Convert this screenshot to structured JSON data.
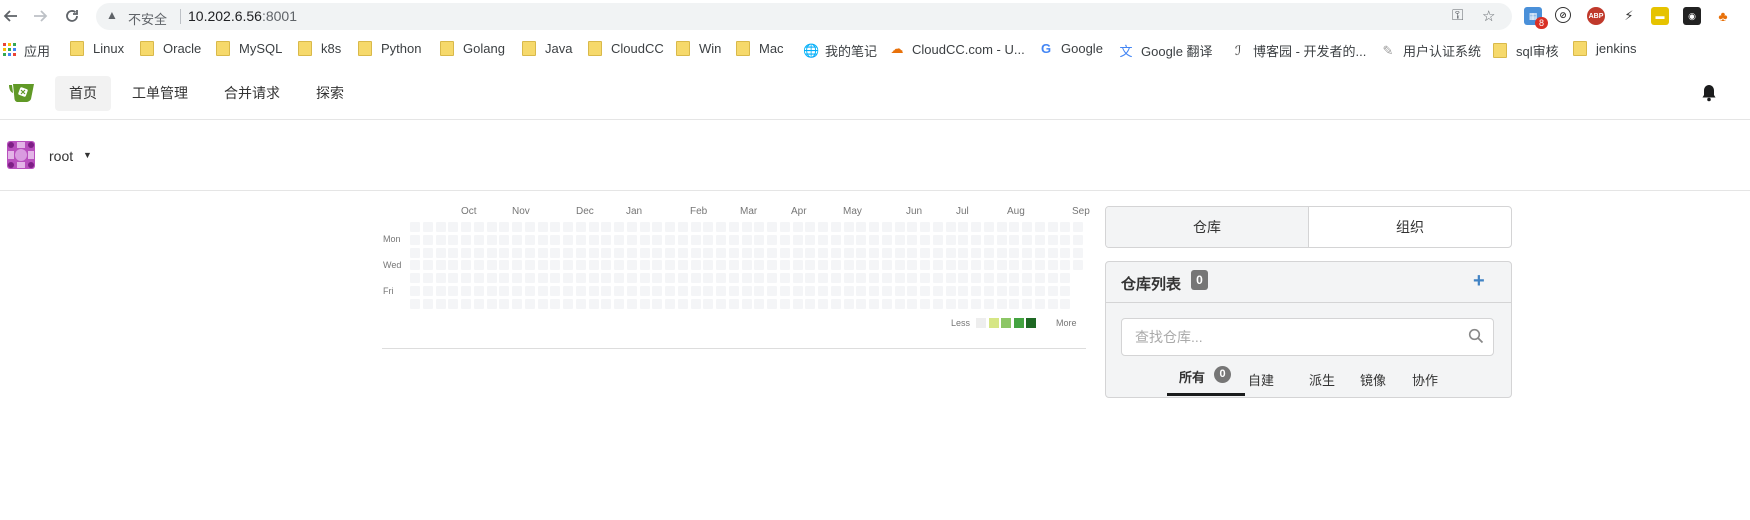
{
  "browser": {
    "insecure_label": "不安全",
    "url_host": "10.202.6.56",
    "url_port": ":8001",
    "extension_badge": "8",
    "abp_label": "ABP"
  },
  "bookmarks": [
    {
      "label": "应用",
      "icon": "apps-grid-icon"
    },
    {
      "label": "Linux",
      "icon": "folder-icon"
    },
    {
      "label": "Oracle",
      "icon": "folder-icon"
    },
    {
      "label": "MySQL",
      "icon": "folder-icon"
    },
    {
      "label": "k8s",
      "icon": "folder-icon"
    },
    {
      "label": "Python",
      "icon": "folder-icon"
    },
    {
      "label": "Golang",
      "icon": "folder-icon"
    },
    {
      "label": "Java",
      "icon": "folder-icon"
    },
    {
      "label": "CloudCC",
      "icon": "folder-icon"
    },
    {
      "label": "Win",
      "icon": "folder-icon"
    },
    {
      "label": "Mac",
      "icon": "folder-icon"
    },
    {
      "label": "我的笔记",
      "icon": "globe-icon"
    },
    {
      "label": "CloudCC.com - U...",
      "icon": "cloud-icon"
    },
    {
      "label": "Google",
      "icon": "google-icon"
    },
    {
      "label": "Google 翻译",
      "icon": "translate-icon"
    },
    {
      "label": "博客园 - 开发者的...",
      "icon": "cnblogs-icon"
    },
    {
      "label": "用户认证系统",
      "icon": "feather-icon"
    },
    {
      "label": "sql审核",
      "icon": "folder-icon"
    },
    {
      "label": "jenkins",
      "icon": "folder-icon"
    }
  ],
  "nav": {
    "items": [
      {
        "label": "首页",
        "active": true
      },
      {
        "label": "工单管理",
        "active": false
      },
      {
        "label": "合并请求",
        "active": false
      },
      {
        "label": "探索",
        "active": false
      }
    ]
  },
  "user": {
    "name": "root"
  },
  "heatmap": {
    "months": [
      "Oct",
      "Nov",
      "Dec",
      "Jan",
      "Feb",
      "Mar",
      "Apr",
      "May",
      "Jun",
      "Jul",
      "Aug",
      "Sep"
    ],
    "days": [
      "Mon",
      "Wed",
      "Fri"
    ],
    "legend_less": "Less",
    "legend_more": "More",
    "legend_colors": [
      "#eeeeee",
      "#d6e685",
      "#8cc665",
      "#44a340",
      "#1e6823"
    ],
    "contributions": 0
  },
  "panel": {
    "tabs": [
      {
        "label": "仓库",
        "active": true
      },
      {
        "label": "组织",
        "active": false
      }
    ],
    "repo_list_title": "仓库列表",
    "repo_count": "0",
    "search_placeholder": "查找仓库...",
    "filters": [
      {
        "label": "所有",
        "count": "0",
        "active": true
      },
      {
        "label": "自建"
      },
      {
        "label": "派生"
      },
      {
        "label": "镜像"
      },
      {
        "label": "协作"
      }
    ]
  }
}
